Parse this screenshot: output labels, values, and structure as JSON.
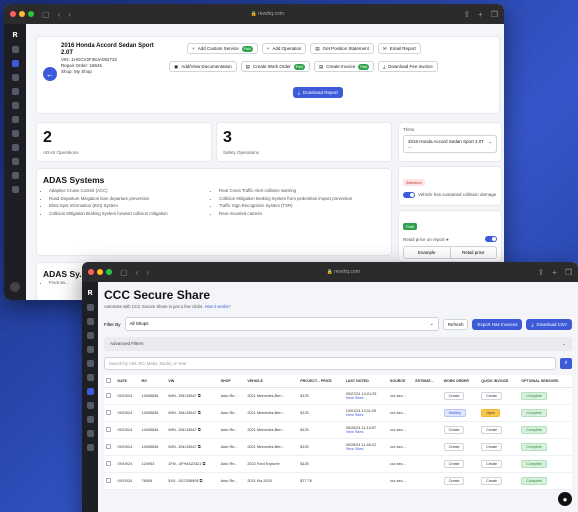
{
  "w1": {
    "url": "revvhq.com",
    "vehicle": {
      "title": "2016 Honda Accord Sedan Sport 2.0T",
      "vin": "VIN: 1HGCV2F38JA052732",
      "repair_order": "Repair Order: 18645",
      "shop": "Shop: My Shop"
    },
    "buttons": {
      "add_custom_service": "Add Custom Service",
      "add_operation": "Add Operation",
      "get_position_statement": "Get Position Statement",
      "email_report": "Email Report",
      "add_view_documentation": "Add/View Documentation",
      "create_work_order": "Create Work Order",
      "create_invoice": "Create Invoice",
      "download_fee_invoice": "Download Fee Invoice",
      "download_report": "Download Report",
      "paid": "Paid"
    },
    "stats": [
      {
        "value": "2",
        "label": "ADAS Operations"
      },
      {
        "value": "3",
        "label": "Safety Operations"
      }
    ],
    "adas": {
      "title": "ADAS Systems",
      "left": [
        "Adaptive Cruise Control (ACC)",
        "Road Departure Mitigation lane departure prevention",
        "Blind Spot Information (BSI) System",
        "Collision Mitigation Braking System forward collision mitigation"
      ],
      "right": [
        "Rear Cross Traffic Alert collision warning",
        "Collision Mitigation Braking System from pedestrian impact prevention",
        "Traffic Sign Recognition System (TSR)",
        "Rear mounted camera"
      ]
    },
    "adas2": {
      "title": "ADAS Sy...",
      "item": "Front an..."
    },
    "side": {
      "trims_label": "Trims",
      "trim_selected": "2016 Honda Accord Sedan Sport 2.0T ...",
      "attention": "Attention",
      "collision": "Vehicle has sustained collision damage",
      "paid": "Paid",
      "retail_label": "Retail price on report",
      "example": "Example",
      "retail_price": "Retail price",
      "paid2": "Paid"
    }
  },
  "w2": {
    "url": "revvhq.com",
    "title": "CCC Secure Share",
    "subtitle": "Automate with CCC Secure Share in just a few clicks.",
    "subtitle_link": "How it works?",
    "filter_label": "Filter By",
    "filter_value": "All Shops",
    "refresh": "Refresh",
    "export": "Export Has Invoices",
    "download_csv": "Download CSV",
    "advanced_filters": "Advanced Filters",
    "search_placeholder": "Search by VIN, RO, Make, Model, or Year",
    "columns": [
      "DATE",
      "RO",
      "VIN",
      "SHOP",
      "VEHICLE",
      "PROJECT... PRICE",
      "LAST NOTED",
      "SOURCE",
      "ESTIMAT...",
      "WORK ORDER",
      "QUICK INVOICE",
      "OPTIONAL SENSORS"
    ],
    "rows": [
      {
        "date": "09/23/24",
        "ro": "14005636",
        "vin": "WIN...DNJ15647",
        "shop": "Auto Re...",
        "vehicle": "2021 Mercedes-Ben...",
        "price": "$125",
        "noted": "09/27/24 14:21:25",
        "source": "ccc sec...",
        "wo": "Create",
        "qi": "Create",
        "sensors": "Complete",
        "wo_style": "",
        "qi_style": ""
      },
      {
        "date": "09/23/24",
        "ro": "14005636",
        "vin": "WIN...DNJ15647",
        "shop": "Auto Re...",
        "vehicle": "2021 Mercedes-Ben...",
        "price": "$125",
        "noted": "10/01/24 13:11:25",
        "source": "ccc sec...",
        "wo": "Waiting",
        "qi": "Open",
        "sensors": "Complete",
        "wo_style": "blue",
        "qi_style": "yel"
      },
      {
        "date": "09/23/24",
        "ro": "14005636",
        "vin": "WIN...DNJ15647",
        "shop": "Auto Re...",
        "vehicle": "2021 Mercedes-Ben...",
        "price": "$125",
        "noted": "09/26/24 11:14:57",
        "source": "ccc sec...",
        "wo": "Create",
        "qi": "Create",
        "sensors": "Complete",
        "wo_style": "",
        "qi_style": ""
      },
      {
        "date": "09/23/24",
        "ro": "14005636",
        "vin": "WIN...DNJ15647",
        "shop": "Auto Re...",
        "vehicle": "2021 Mercedes-Ben...",
        "price": "$125",
        "noted": "09/26/24 11:46:22",
        "source": "ccc sec...",
        "wo": "Create",
        "qi": "Create",
        "sensors": "Complete",
        "wo_style": "",
        "qi_style": ""
      },
      {
        "date": "09/19/24",
        "ro": "124953",
        "vin": "1FM...4FH4A22421",
        "shop": "Auto Re...",
        "vehicle": "2022 Ford Explorer",
        "price": "$125",
        "noted": "",
        "source": "ccc sec...",
        "wo": "Create",
        "qi": "Create",
        "sensors": "Complete",
        "wo_style": "",
        "qi_style": ""
      },
      {
        "date": "09/19/24",
        "ro": "78405",
        "vin": "5XX...5G7038904",
        "shop": "Auto Re...",
        "vehicle": "2021 Kia 2020",
        "price": "$77.76",
        "noted": "",
        "source": "ccc sec...",
        "wo": "Create",
        "qi": "Create",
        "sensors": "Complete",
        "wo_style": "",
        "qi_style": ""
      }
    ],
    "view_sites": "View Sites"
  }
}
